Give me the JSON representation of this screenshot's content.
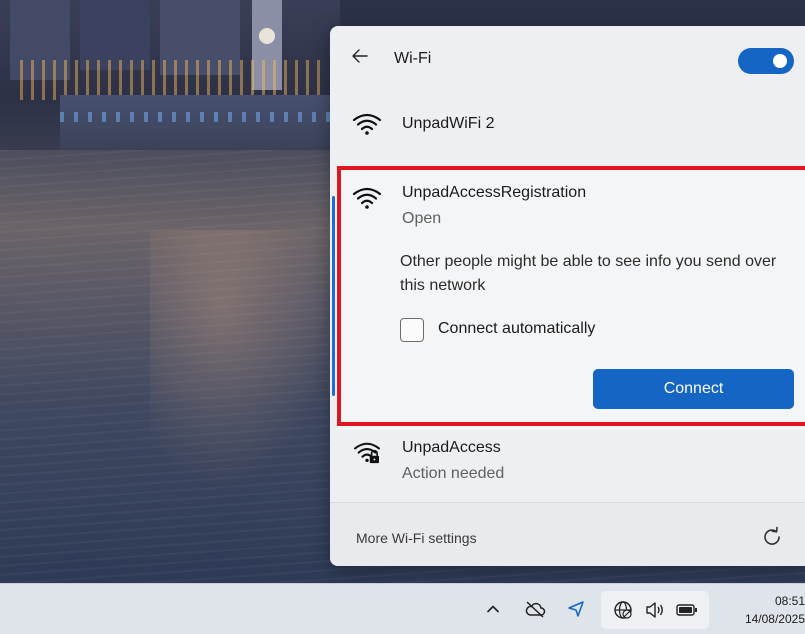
{
  "flyout": {
    "title": "Wi-Fi",
    "wifi_enabled": true,
    "networks": [
      {
        "name": "UnpadWiFi 2",
        "status": "",
        "icon": "wifi-signal-icon",
        "secured": false
      },
      {
        "name": "UnpadAccessRegistration",
        "status": "Open",
        "icon": "wifi-signal-icon",
        "secured": false,
        "expanded": true
      },
      {
        "name": "UnpadAccess",
        "status": "Action needed",
        "icon": "wifi-lock-icon",
        "secured": true
      }
    ],
    "expanded_network": {
      "warning": "Other people might be able to see info you send over this network",
      "auto_connect_label": "Connect automatically",
      "auto_connect_checked": false,
      "connect_label": "Connect"
    },
    "footer": {
      "settings_link": "More Wi-Fi settings",
      "refresh_icon": "refresh-icon"
    }
  },
  "taskbar": {
    "tray_icons": [
      "chevron-up-icon",
      "cloud-off-icon",
      "location-icon",
      "globe-network-icon",
      "speaker-icon",
      "battery-icon"
    ],
    "time": "08:51",
    "date": "14/08/2025"
  },
  "colors": {
    "accent": "#1465c4",
    "highlight": "#e0161e"
  }
}
